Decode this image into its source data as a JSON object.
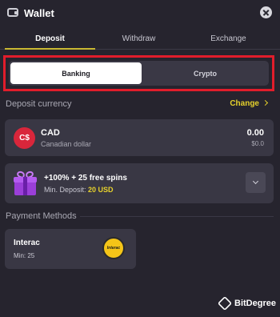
{
  "header": {
    "title": "Wallet"
  },
  "tabs": [
    {
      "label": "Deposit",
      "active": true
    },
    {
      "label": "Withdraw",
      "active": false
    },
    {
      "label": "Exchange",
      "active": false
    }
  ],
  "method_toggle": {
    "banking": "Banking",
    "crypto": "Crypto",
    "selected": "Banking"
  },
  "deposit_currency": {
    "title": "Deposit currency",
    "change_label": "Change",
    "badge": "C$",
    "code": "CAD",
    "name": "Canadian dollar",
    "amount": "0.00",
    "fiat_amount": "$0.0"
  },
  "bonus": {
    "title": "+100% + 25 free spins",
    "min_label": "Min. Deposit:",
    "min_amount": "20 USD"
  },
  "payment_methods": {
    "title": "Payment Methods",
    "items": [
      {
        "name": "Interac",
        "min": "Min: 25",
        "logo_text": "Interac"
      }
    ]
  },
  "watermark": {
    "text": "BitDegree"
  },
  "colors": {
    "accent": "#e6d12c",
    "highlight_frame": "#e11d2b",
    "background": "#26242e",
    "card": "#393744"
  }
}
